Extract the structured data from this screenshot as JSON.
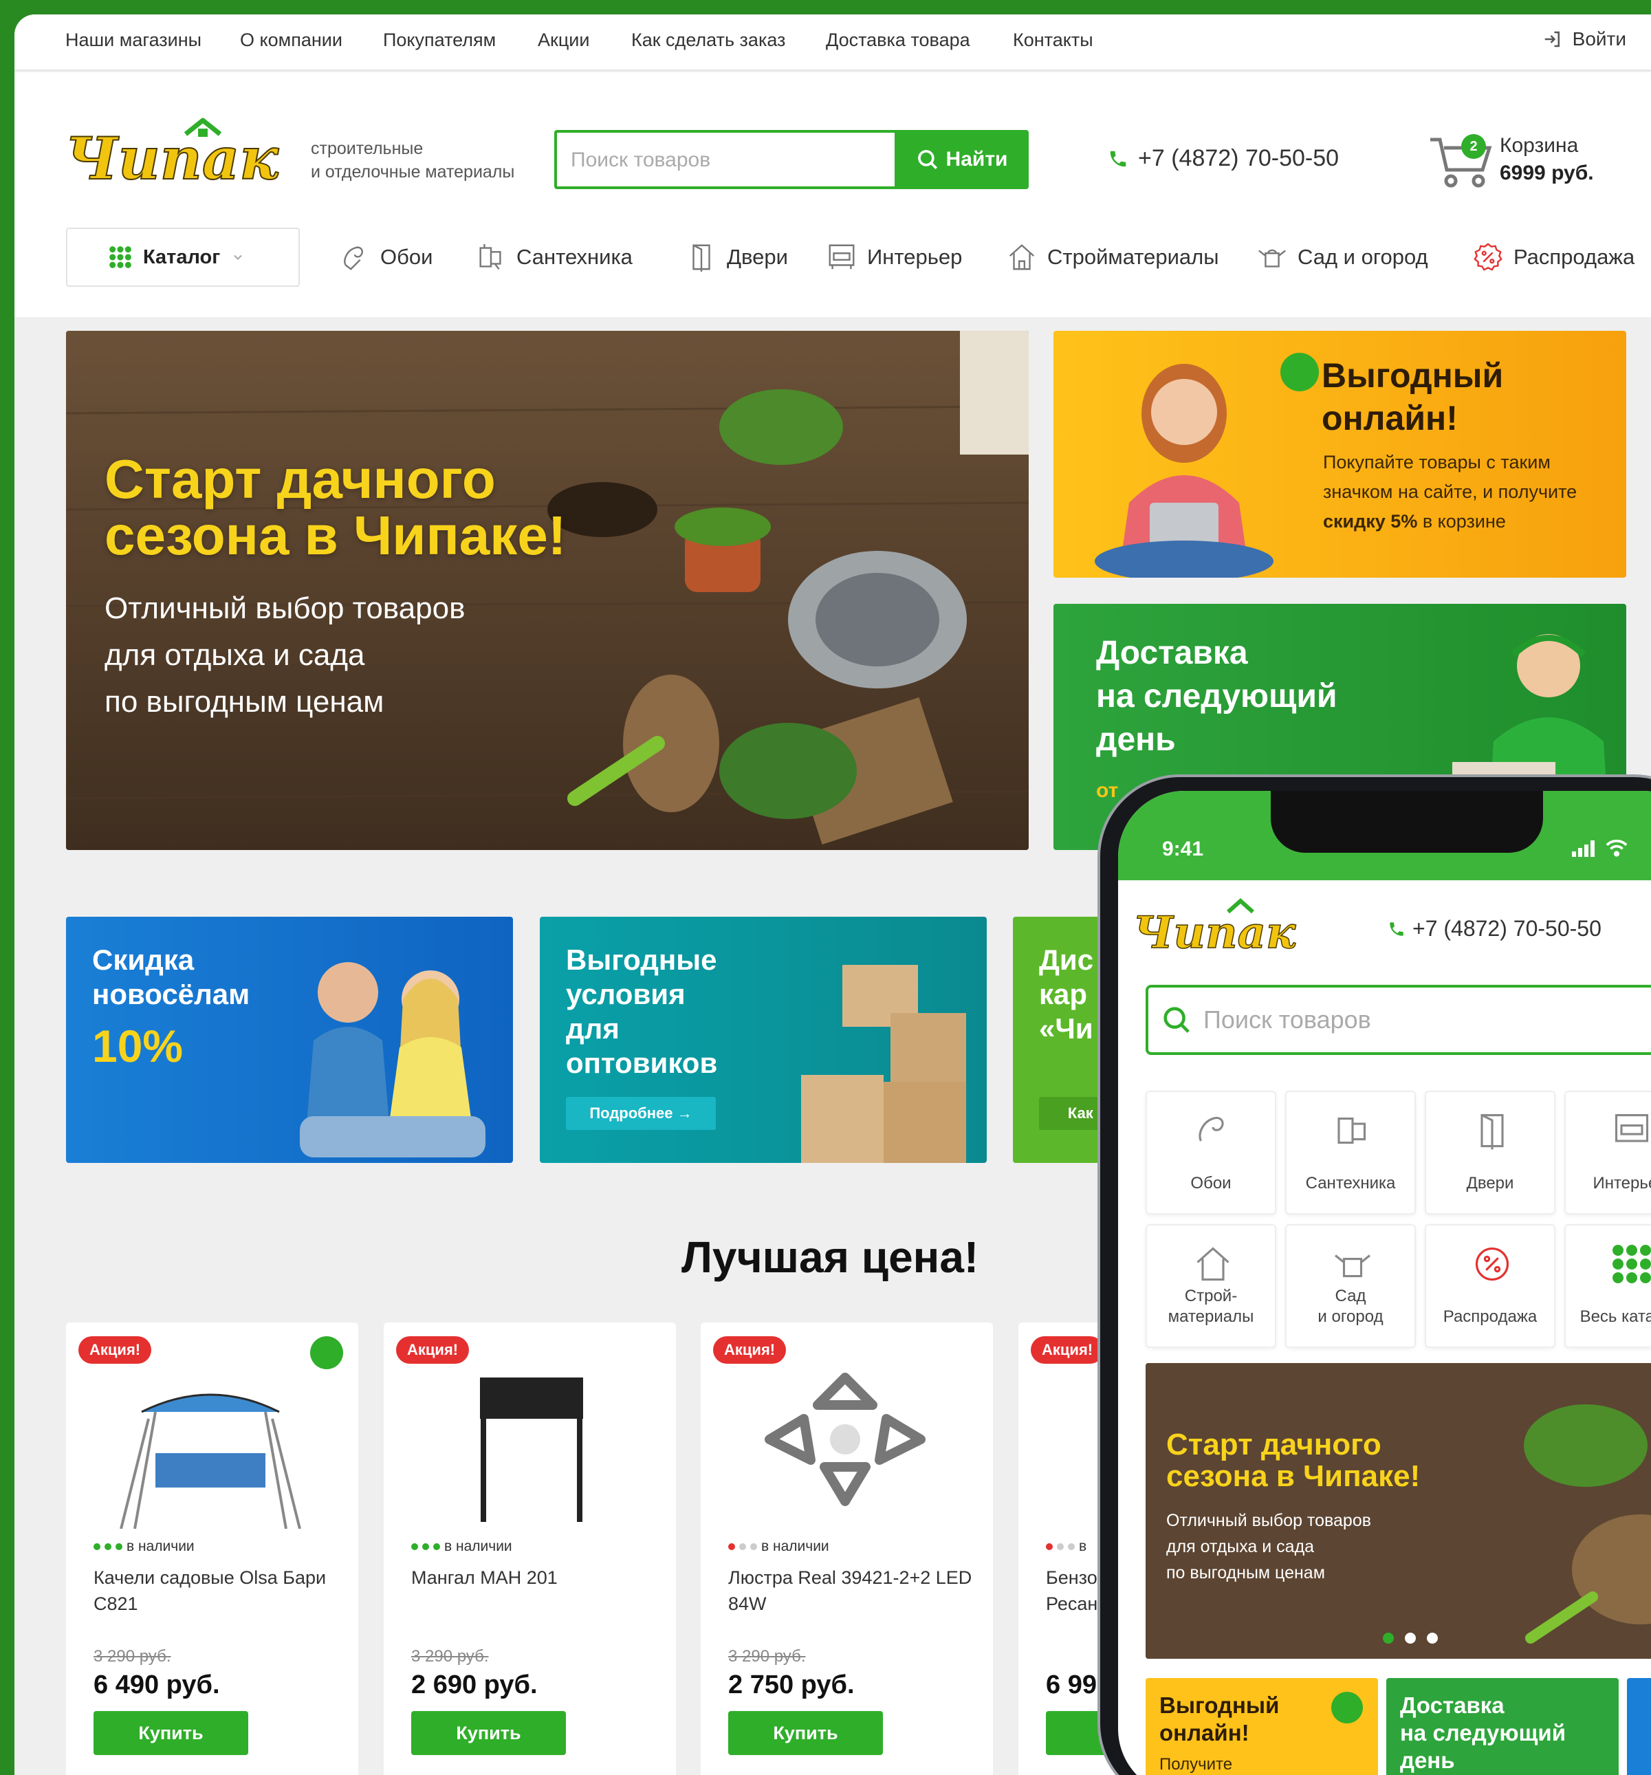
{
  "colors": {
    "brand": "#2fae2a",
    "accent": "#f8d31c",
    "sale": "#e53030",
    "frame": "#2a8a22"
  },
  "topbar": {
    "links": [
      "Наши магазины",
      "О компании",
      "Покупателям",
      "Акции",
      "Как сделать заказ",
      "Доставка товара",
      "Контакты"
    ],
    "login": "Войти"
  },
  "header": {
    "tagline": "строительные\nи отделочные материалы",
    "search_placeholder": "Поиск товаров",
    "search_button": "Найти",
    "phone": "+7 (4872) 70-50-50",
    "cart_label": "Корзина",
    "cart_total": "6999 руб.",
    "cart_count": "2"
  },
  "nav": {
    "catalog": "Каталог",
    "items": [
      "Обои",
      "Сантехника",
      "Двери",
      "Интерьер",
      "Стройматериалы",
      "Сад и огород",
      "Распродажа"
    ]
  },
  "hero": {
    "title": "Старт дачного\nсезона в Чипаке!",
    "subtitle": "Отличный выбор товаров\nдля отдыха и сада\nпо выгодным ценам"
  },
  "promo1": {
    "title": "Выгодный\nонлайн!",
    "text_before": "Покупайте товары с таким значком на сайте, и получите ",
    "text_bold": "скидку 5%",
    "text_after": " в корзине"
  },
  "promo2": {
    "title": "Доставка\nна следующий\nдень",
    "from": "от"
  },
  "cards": [
    {
      "title": "Скидка\nновосёлам",
      "discount": "10%"
    },
    {
      "title": "Выгодные\nусловия\nдля\nоптовиков",
      "button": "Подробнее →"
    },
    {
      "title": "Дис\nкар\n«Чи",
      "button": "Как п"
    }
  ],
  "section_title": "Лучшая цена!",
  "products": [
    {
      "badge": "Акция!",
      "stock": "в наличии",
      "name": "Качели садовые Olsa Бари С821",
      "old_price": "3 290 руб.",
      "price": "6 490 руб.",
      "buy": "Купить"
    },
    {
      "badge": "Акция!",
      "stock": "в наличии",
      "name": "Мангал МАН 201",
      "old_price": "3 290 руб.",
      "price": "2 690 руб.",
      "buy": "Купить"
    },
    {
      "badge": "Акция!",
      "stock": "в наличии",
      "name": "Люстра Real 39421-2+2 LED 84W",
      "old_price": "3 290 руб.",
      "price": "2 750 руб.",
      "buy": "Купить"
    },
    {
      "badge": "Акция!",
      "stock": "в",
      "name": "Бензо\nРесан",
      "old_price": "",
      "price": "6 99",
      "buy": "К"
    }
  ],
  "phone_app": {
    "time": "9:41",
    "phone": "+7 (4872) 70-50-50",
    "search_placeholder": "Поиск товаров",
    "tiles": [
      "Обои",
      "Сантехника",
      "Двери",
      "Интерьер",
      "Строй-\nматериалы",
      "Сад\nи огород",
      "Распродажа",
      "Весь каталог"
    ],
    "hero_title": "Старт дачного\nсезона в Чипаке!",
    "hero_sub": "Отличный выбор товаров\nдля отдыха и сада\nпо выгодным ценам",
    "card1_title": "Выгодный\nонлайн!",
    "card1_text": "Получите",
    "card2_title": "Доставка\nна следующий\nдень"
  }
}
